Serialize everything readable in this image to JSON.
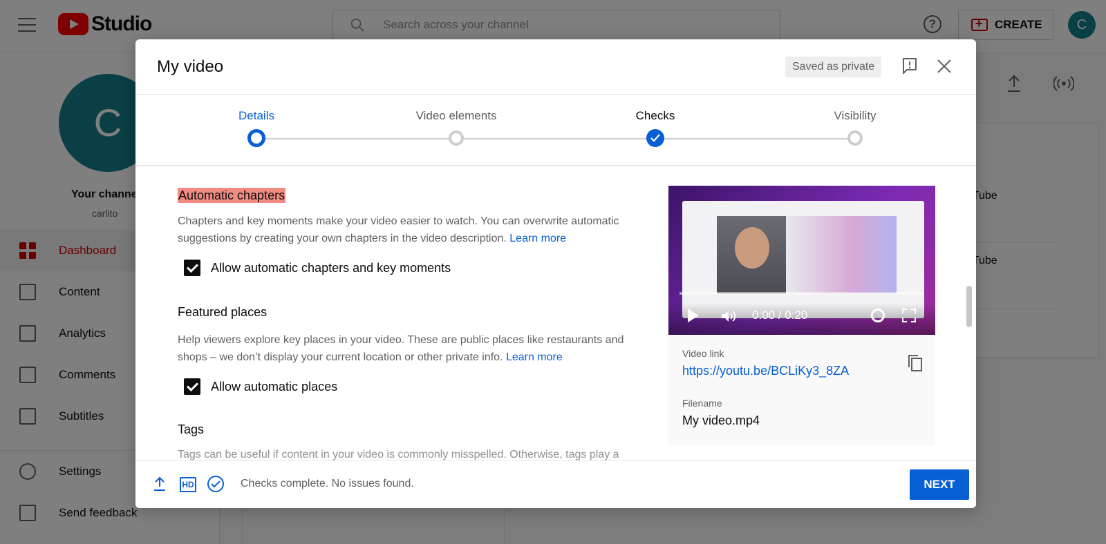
{
  "background": {
    "logo_text": "Studio",
    "search_placeholder": "Search across your channel",
    "create_label": "CREATE",
    "avatar_letter": "C",
    "channel": {
      "name": "Your channel",
      "handle": "carlito"
    },
    "nav": [
      {
        "label": "Dashboard",
        "icon": "dashboard-icon",
        "active": true
      },
      {
        "label": "Content",
        "icon": "content-icon"
      },
      {
        "label": "Analytics",
        "icon": "analytics-icon"
      },
      {
        "label": "Comments",
        "icon": "comments-icon"
      },
      {
        "label": "Subtitles",
        "icon": "subtitles-icon"
      },
      {
        "label": "Settings",
        "icon": "gear-icon"
      },
      {
        "label": "Send feedback",
        "icon": "feedback-icon"
      }
    ],
    "right_panel": {
      "line1": "ouTube",
      "line2": "ouTube",
      "header_glyph": "o"
    }
  },
  "modal": {
    "title": "My video",
    "saved_status": "Saved as private",
    "steps": [
      {
        "label": "Details",
        "state": "current"
      },
      {
        "label": "Video elements",
        "state": "pending"
      },
      {
        "label": "Checks",
        "state": "done"
      },
      {
        "label": "Visibility",
        "state": "pending"
      }
    ],
    "sections": {
      "chapters": {
        "title": "Automatic chapters",
        "description": "Chapters and key moments make your video easier to watch. You can overwrite automatic suggestions by creating your own chapters in the video description.",
        "learn_more": "Learn more",
        "checkbox_label": "Allow automatic chapters and key moments",
        "checked": true
      },
      "places": {
        "title": "Featured places",
        "description": "Help viewers explore key places in your video. These are public places like restaurants and shops – we don’t display your current location or other private info.",
        "learn_more": "Learn more",
        "checkbox_label": "Allow automatic places",
        "checked": true
      },
      "tags": {
        "title": "Tags",
        "partial_text": "Tags can be useful if content in your video is commonly misspelled. Otherwise, tags play a"
      }
    },
    "video": {
      "time": "0:00 / 0:20",
      "link_label": "Video link",
      "link": "https://youtu.be/BCLiKy3_8ZA",
      "filename_label": "Filename",
      "filename": "My video.mp4"
    },
    "footer": {
      "hd_label": "HD",
      "status": "Checks complete. No issues found.",
      "next_label": "NEXT"
    }
  }
}
